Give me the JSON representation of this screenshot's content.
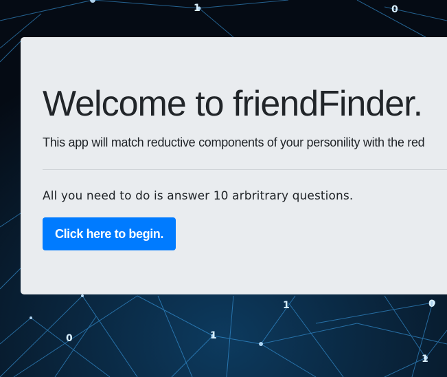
{
  "jumbotron": {
    "title": "Welcome to friendFinder.",
    "lead": "This app will match reductive components of your personility with the red",
    "info": "All you need to do is answer 10 arbritrary questions.",
    "button_label": "Click here to begin."
  },
  "background": {
    "glyphs": [
      "1",
      "1",
      "1",
      "0",
      "1",
      "0",
      "0"
    ]
  },
  "colors": {
    "button": "#007bff",
    "panel": "#e9ecef",
    "network_line": "#3fa9f5"
  }
}
